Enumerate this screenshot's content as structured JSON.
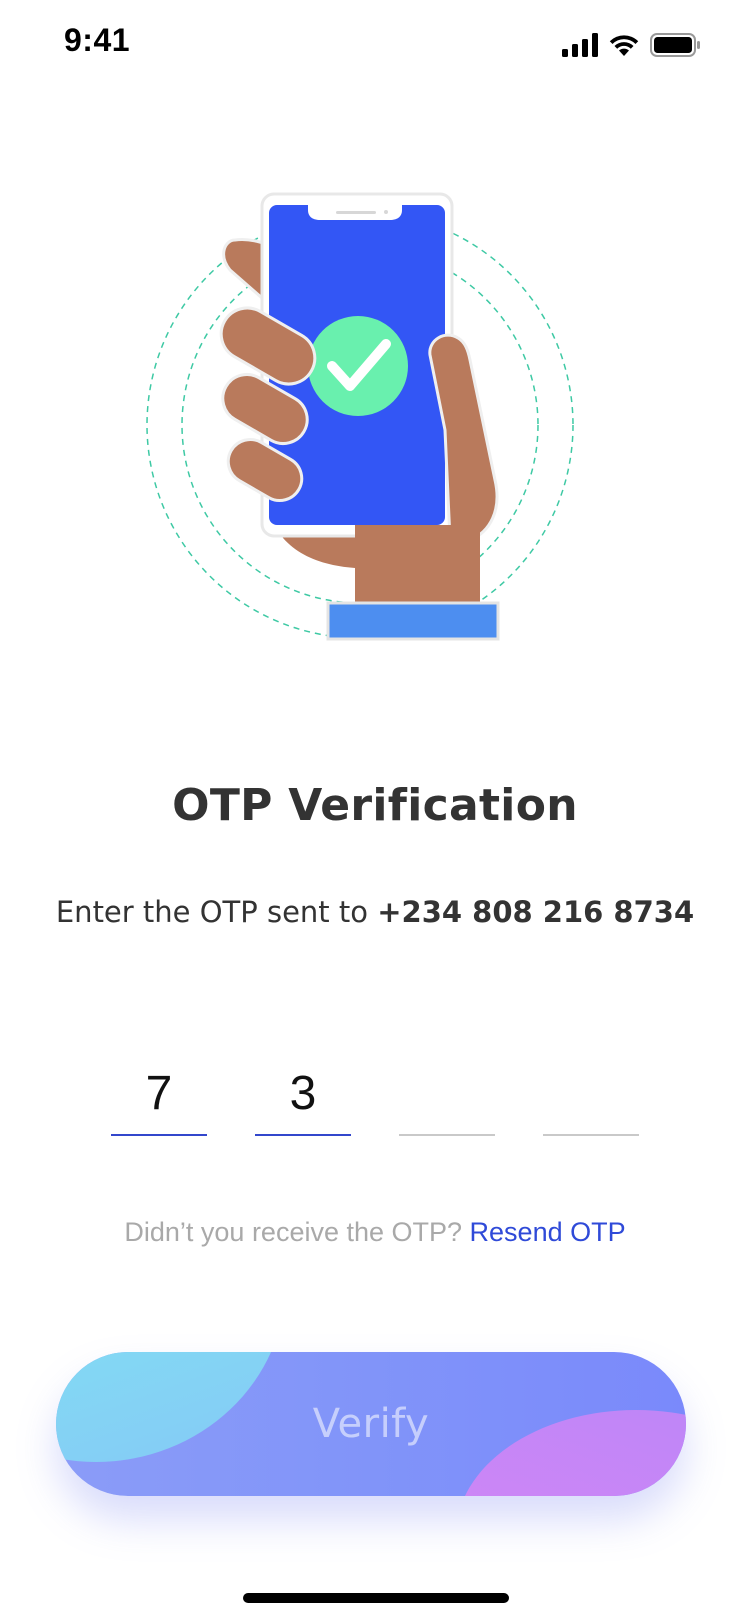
{
  "status_bar": {
    "time": "9:41",
    "icons": [
      "cellular-signal-icon",
      "wifi-icon",
      "battery-icon"
    ]
  },
  "illustration": {
    "icon": "phone-verified-hand-illustration",
    "colors": {
      "screen": "#3356f5",
      "check_circle": "#69f0ae",
      "skin": "#b97a5c",
      "sleeve": "#4d8ef0",
      "rings": "#3ec9a4"
    }
  },
  "title": "OTP Verification",
  "subtitle": {
    "prefix": "Enter the OTP sent to ",
    "phone": "+234 808 216 8734"
  },
  "otp": {
    "digits": [
      "7",
      "3",
      "",
      ""
    ]
  },
  "resend": {
    "prompt": "Didn’t you receive the OTP? ",
    "link": "Resend OTP"
  },
  "verify_button": {
    "label": "Verify"
  },
  "colors": {
    "accent": "#2f4ad8",
    "active_underline": "#3347cc",
    "inactive_underline": "#c9c9c9"
  }
}
